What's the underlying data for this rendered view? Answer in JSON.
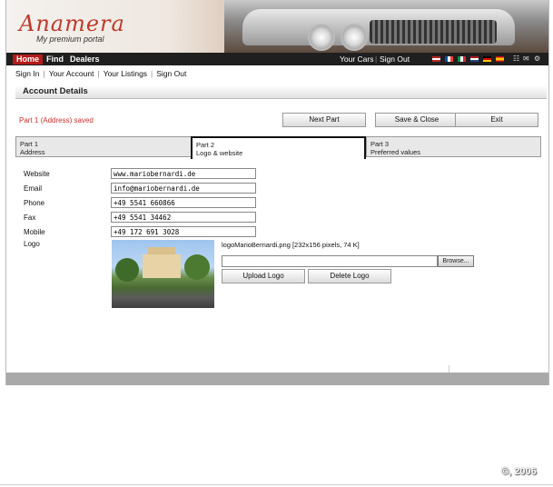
{
  "brand": {
    "logo_text": "Anamera",
    "tagline": "My premium portal"
  },
  "nav": {
    "tabs": [
      "Home",
      "Find",
      "Dealers"
    ],
    "right_links": [
      "Your Cars",
      "Sign Out"
    ],
    "flags": [
      "us-flag",
      "fr-flag",
      "it-flag",
      "nl-flag",
      "de-flag",
      "es-flag"
    ],
    "tool_icons": [
      "sitemap-icon",
      "mail-icon",
      "settings-icon"
    ]
  },
  "subnav": [
    "Sign In",
    "Your Account",
    "Your Listings",
    "Sign Out"
  ],
  "section": {
    "title": "Account Details"
  },
  "status_message": "Part 1 (Address) saved",
  "actions": {
    "next": "Next Part",
    "save_close": "Save & Close",
    "exit": "Exit"
  },
  "steps": [
    {
      "title": "Part 1",
      "subtitle": "Address",
      "active": false
    },
    {
      "title": "Part 2",
      "subtitle": "Logo & website",
      "active": true
    },
    {
      "title": "Part 3",
      "subtitle": "Preferred values",
      "active": false
    }
  ],
  "fields": {
    "website": {
      "label": "Website",
      "value": "www.mariobernardi.de"
    },
    "email": {
      "label": "Email",
      "value": "info@mariobernardi.de"
    },
    "phone": {
      "label": "Phone",
      "value": "+49 5541 660866"
    },
    "fax": {
      "label": "Fax",
      "value": "+49 5541 34462"
    },
    "mobile": {
      "label": "Mobile",
      "value": "+49 172 691 3028"
    },
    "logo": {
      "label": "Logo"
    }
  },
  "logo_upload": {
    "file_info": "logoMarioBernardi.png [232x156 pixels, 74 K]",
    "browse": "Browse...",
    "upload": "Upload Logo",
    "delete": "Delete Logo"
  },
  "copyright": "©, 2006"
}
